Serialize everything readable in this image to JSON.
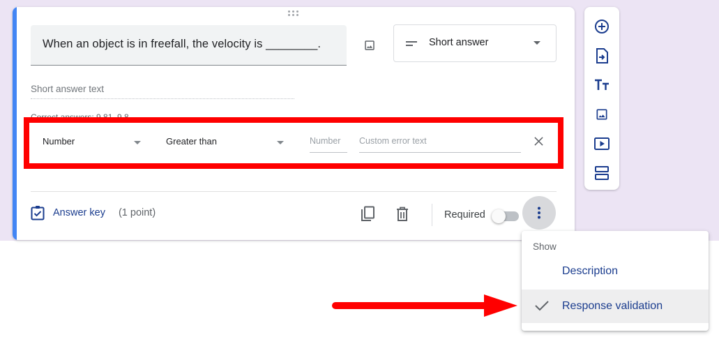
{
  "question": {
    "title": "When an object is in freefall, the velocity is ________.",
    "type_label": "Short answer",
    "answer_placeholder": "Short answer text",
    "clipped_line": "Correct answers: 9.81, 9.8"
  },
  "validation": {
    "type": "Number",
    "condition": "Greater than",
    "number_placeholder": "Number",
    "error_placeholder": "Custom error text"
  },
  "footer": {
    "answer_key": "Answer key",
    "points": "(1 point)",
    "required": "Required"
  },
  "menu": {
    "header": "Show",
    "items": [
      {
        "label": "Description",
        "checked": false
      },
      {
        "label": "Response validation",
        "checked": true
      }
    ]
  },
  "toolbar": {
    "icons": [
      "add-question-icon",
      "import-questions-icon",
      "add-title-icon",
      "add-image-icon",
      "add-video-icon",
      "add-section-icon"
    ]
  },
  "colors": {
    "background": "#ece4f4",
    "accent": "#4285f4",
    "annotation": "#ff0000",
    "link_text": "#1a3c8e"
  }
}
